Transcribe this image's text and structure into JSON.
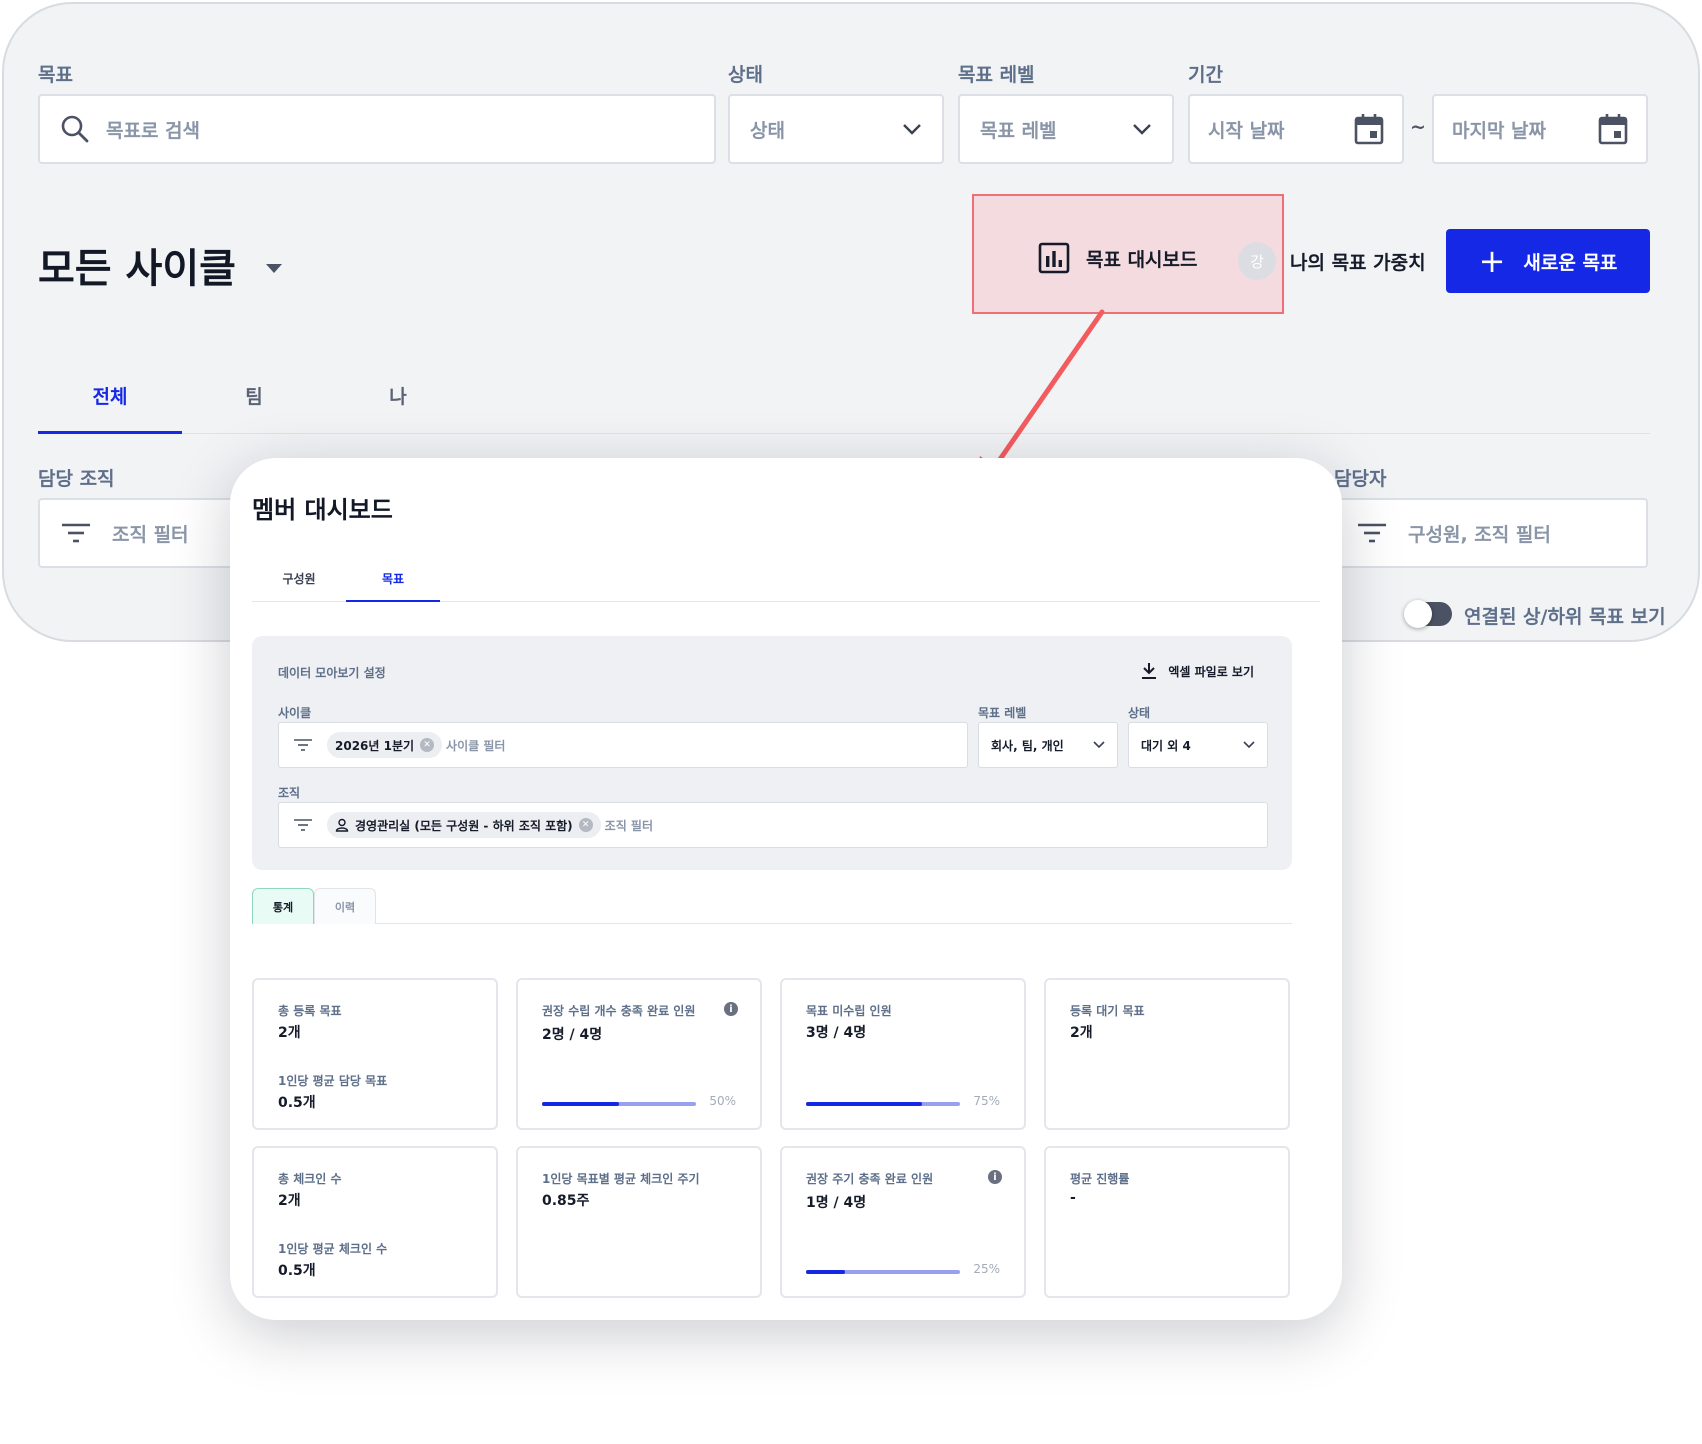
{
  "filters": {
    "goal_label": "목표",
    "goal_placeholder": "목표로 검색",
    "status_label": "상태",
    "status_placeholder": "상태",
    "level_label": "목표 레벨",
    "level_placeholder": "목표 레벨",
    "period_label": "기간",
    "start_placeholder": "시작 날짜",
    "period_separator": "~",
    "end_placeholder": "마지막 날짜"
  },
  "cycle": {
    "title": "모든 사이클"
  },
  "actions": {
    "dashboard_label": "목표 대시보드",
    "avatar_text": "강",
    "weight_label": "나의 목표 가중치",
    "new_goal_label": "새로운 목표"
  },
  "tabs": [
    {
      "label": "전체",
      "active": true
    },
    {
      "label": "팀",
      "active": false
    },
    {
      "label": "나",
      "active": false
    }
  ],
  "org_filter": {
    "label": "담당 조직",
    "placeholder": "조직 필터"
  },
  "assignee_filter": {
    "label": "담당자",
    "placeholder": "구성원, 조직 필터"
  },
  "toggle": {
    "label": "연결된 상/하위 목표 보기",
    "on": false
  },
  "dashboard": {
    "title": "멤버 대시보드",
    "tabs": [
      {
        "label": "구성원",
        "active": false
      },
      {
        "label": "목표",
        "active": true
      }
    ],
    "settings": {
      "title": "데이터 모아보기 설정",
      "excel_label": "엑셀 파일로 보기",
      "cycle_label": "사이클",
      "cycle_chip": "2026년 1분기",
      "cycle_placeholder": "사이클 필터",
      "level_label": "목표 레벨",
      "level_value": "회사, 팀, 개인",
      "status_label": "상태",
      "status_value": "대기 외 4",
      "org_label": "조직",
      "org_chip": "경영관리실 (모든 구성원 - 하위 조직 포함)",
      "org_placeholder": "조직 필터"
    },
    "stat_tabs": [
      {
        "label": "통계",
        "active": true
      },
      {
        "label": "이력",
        "active": false
      }
    ],
    "cards": [
      {
        "label": "총 등록 목표",
        "value": "2개",
        "sub_label": "1인당 평균 담당 목표",
        "sub_value": "0.5개"
      },
      {
        "label": "권장 수립 개수 충족 완료 인원",
        "value": "2명 / 4명",
        "info": true,
        "progress": 0.5,
        "pct": "50%"
      },
      {
        "label": "목표 미수립 인원",
        "value": "3명 / 4명",
        "progress": 0.75,
        "pct": "75%"
      },
      {
        "label": "등록 대기 목표",
        "value": "2개"
      },
      {
        "label": "총 체크인 수",
        "value": "2개",
        "sub_label": "1인당 평균 체크인 수",
        "sub_value": "0.5개"
      },
      {
        "label": "1인당 목표별 평균 체크인 주기",
        "value": "0.85주"
      },
      {
        "label": "권장 주기 충족 완료 인원",
        "value": "1명 / 4명",
        "info": true,
        "progress": 0.25,
        "pct": "25%"
      },
      {
        "label": "평균 진행률",
        "value": "-"
      }
    ]
  },
  "colors": {
    "accent": "#1428e6",
    "highlight_border": "#ef6f76",
    "arrow": "#f25c5f"
  },
  "icons": [
    "search-icon",
    "chevron-down-icon",
    "calendar-icon",
    "bar-chart-icon",
    "plus-icon",
    "filter-icon",
    "download-icon",
    "user-icon",
    "close-icon",
    "info-icon"
  ]
}
